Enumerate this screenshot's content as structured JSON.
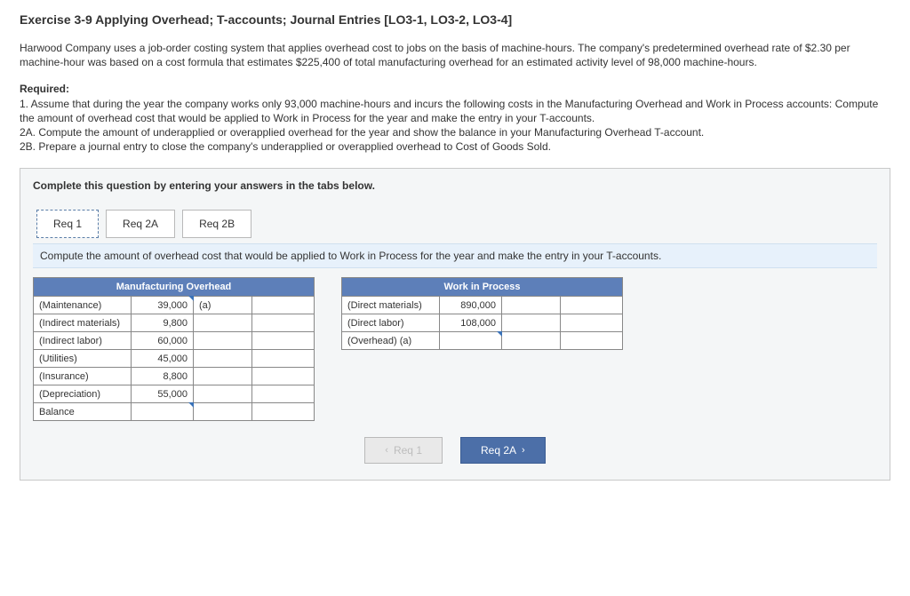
{
  "title": "Exercise 3-9 Applying Overhead; T-accounts; Journal Entries [LO3-1, LO3-2, LO3-4]",
  "intro": "Harwood Company uses a job-order costing system that applies overhead cost to jobs on the basis of machine-hours. The company's predetermined overhead rate of $2.30 per machine-hour was based on a cost formula that estimates $225,400 of total manufacturing overhead for an estimated activity level of 98,000 machine-hours.",
  "required_label": "Required:",
  "req_1": "1. Assume that during the year the company works only 93,000 machine-hours and incurs the following costs in the Manufacturing Overhead and Work in Process accounts: Compute the amount of overhead cost that would be applied to Work in Process for the year and make the entry in your T-accounts.",
  "req_2a": "2A. Compute the amount of underapplied or overapplied overhead for the year and show the balance in your Manufacturing Overhead T-account.",
  "req_2b": "2B. Prepare a journal entry to close the company's underapplied or overapplied overhead to Cost of Goods Sold.",
  "panel_instr": "Complete this question by entering your answers in the tabs below.",
  "tabs": {
    "req1": "Req 1",
    "req2a": "Req 2A",
    "req2b": "Req 2B"
  },
  "subinstr": "Compute the amount of overhead cost that would be applied to Work in Process for the year and make the entry in your T-accounts.",
  "mo": {
    "header": "Manufacturing Overhead",
    "rows": [
      {
        "label": "(Maintenance)",
        "debit": "39,000",
        "credit_label": "(a)",
        "credit": ""
      },
      {
        "label": "(Indirect materials)",
        "debit": "9,800",
        "credit_label": "",
        "credit": ""
      },
      {
        "label": "(Indirect labor)",
        "debit": "60,000",
        "credit_label": "",
        "credit": ""
      },
      {
        "label": "(Utilities)",
        "debit": "45,000",
        "credit_label": "",
        "credit": ""
      },
      {
        "label": "(Insurance)",
        "debit": "8,800",
        "credit_label": "",
        "credit": ""
      },
      {
        "label": "(Depreciation)",
        "debit": "55,000",
        "credit_label": "",
        "credit": ""
      },
      {
        "label": "Balance",
        "debit": "",
        "credit_label": "",
        "credit": ""
      }
    ]
  },
  "wip": {
    "header": "Work in Process",
    "rows": [
      {
        "label": "(Direct materials)",
        "debit": "890,000",
        "credit_label": "",
        "credit": ""
      },
      {
        "label": "(Direct labor)",
        "debit": "108,000",
        "credit_label": "",
        "credit": ""
      },
      {
        "label": "(Overhead) (a)",
        "debit": "",
        "credit_label": "",
        "credit": ""
      }
    ]
  },
  "nav": {
    "prev": "Req 1",
    "next": "Req 2A"
  }
}
